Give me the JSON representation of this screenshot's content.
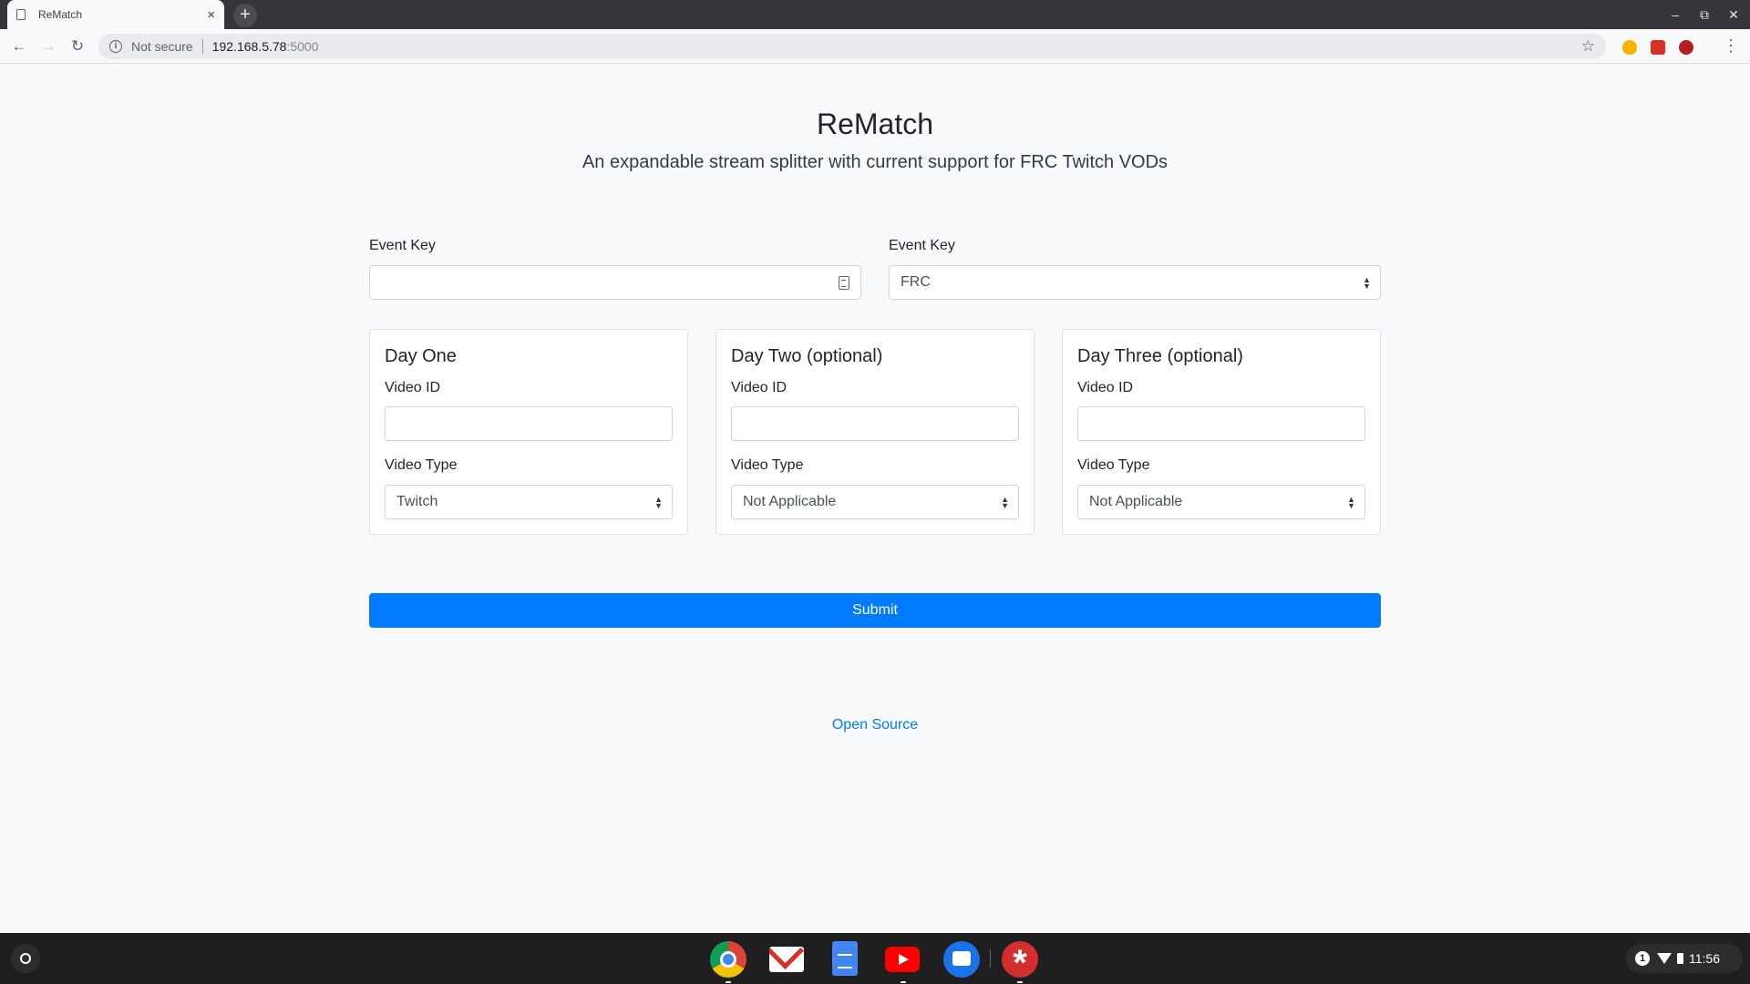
{
  "browser": {
    "tab_title": "ReMatch",
    "tab_close": "×",
    "new_tab": "+",
    "address_security": "Not secure",
    "address_host": "192.168.5.78",
    "address_port": ":5000",
    "icons": [
      "page-icon",
      "back-icon",
      "forward-icon",
      "reload-icon",
      "info-icon",
      "star-icon",
      "menu-icon"
    ]
  },
  "page": {
    "title": "ReMatch",
    "subtitle": "An expandable stream splitter with current support for FRC Twitch VODs",
    "event_key_label": "Event Key",
    "event_key_value": "",
    "event_type_label": "Event Key",
    "event_type_value": "FRC",
    "days": [
      {
        "title": "Day One",
        "video_id_label": "Video ID",
        "video_id_value": "",
        "video_type_label": "Video Type",
        "video_type_value": "Twitch"
      },
      {
        "title": "Day Two (optional)",
        "video_id_label": "Video ID",
        "video_id_value": "",
        "video_type_label": "Video Type",
        "video_type_value": "Not Applicable"
      },
      {
        "title": "Day Three (optional)",
        "video_id_label": "Video ID",
        "video_id_value": "",
        "video_type_label": "Video Type",
        "video_type_value": "Not Applicable"
      }
    ],
    "submit_label": "Submit",
    "footer_link": "Open Source",
    "accent_color": "#007bff"
  },
  "shelf": {
    "apps": [
      "chrome",
      "gmail",
      "docs",
      "youtube",
      "messages",
      "asterisk-app"
    ],
    "notification_count": "1",
    "time": "11:56"
  }
}
